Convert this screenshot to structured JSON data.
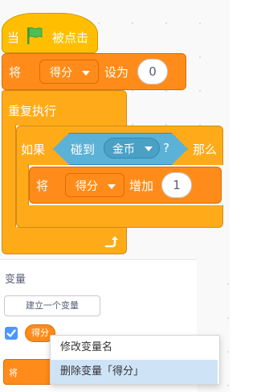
{
  "script": {
    "hat": {
      "when_label": "当",
      "flag_icon": "green-flag-icon",
      "clicked_label": "被点击"
    },
    "set_block": {
      "label_set": "将",
      "variable": "得分",
      "label_to": "设为",
      "value": "0"
    },
    "forever_block": {
      "label": "重复执行",
      "loop_icon": "loop-arrow-icon"
    },
    "if_block": {
      "label_if": "如果",
      "label_then": "那么"
    },
    "touching_block": {
      "label": "碰到",
      "target": "金币",
      "question": "?"
    },
    "change_block": {
      "label_change": "将",
      "variable": "得分",
      "label_by": "增加",
      "value": "1"
    }
  },
  "palette": {
    "section_title": "变量",
    "make_variable_button": "建立一个变量",
    "variable_reporter": "得分",
    "variable_checked": true,
    "partial_block_label": "将"
  },
  "context_menu": {
    "items": [
      "修改变量名",
      "删除变量「得分」"
    ],
    "highlighted_index": 1
  },
  "colors": {
    "events": "#ffbf00",
    "variables": "#ff8c1a",
    "control": "#ffab19",
    "sensing": "#5cb1d6",
    "checkbox": "#4c97ff",
    "menu_highlight": "#cfe3f7"
  }
}
